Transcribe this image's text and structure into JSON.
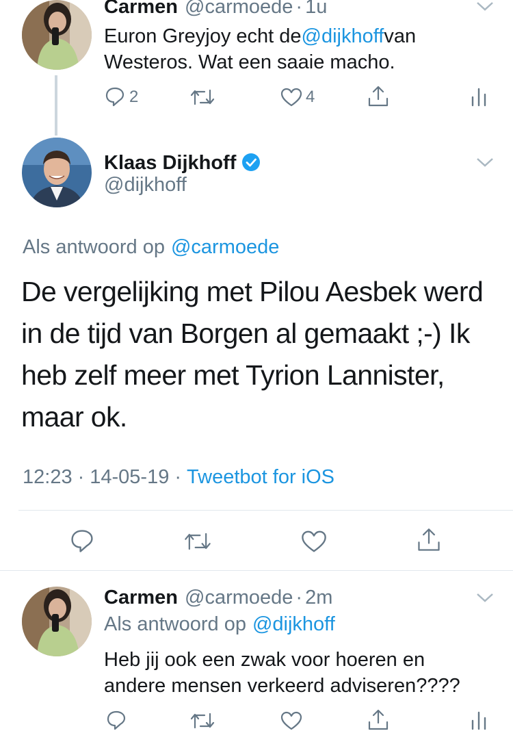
{
  "tweets": [
    {
      "name": "Carmen",
      "handle": "@carmoede",
      "sep": "·",
      "time": "1u",
      "text_parts": [
        "Euron Greyjoy echt de ",
        "@dijkhoff",
        " van"
      ],
      "text_line2": "Westeros. Wat een saaie macho.",
      "replies": "2",
      "likes": "4"
    },
    {
      "name": "Carmen",
      "handle": "@carmoede",
      "sep": "·",
      "time": "2m",
      "reply_prefix": "Als antwoord op",
      "reply_to": "@dijkhoff",
      "text_line1": "Heb jij ook een zwak voor hoeren en",
      "text_line2": "andere mensen verkeerd adviseren????"
    }
  ],
  "main": {
    "name": "Klaas Dijkhoff",
    "handle": "@dijkhoff",
    "reply_prefix": "Als antwoord op",
    "reply_to": "@carmoede",
    "lines": [
      "De vergelijking met Pilou Aesbek werd",
      "in de tijd van Borgen al gemaakt ;-) Ik",
      "heb zelf meer met Tyrion Lannister,",
      "maar ok."
    ],
    "time": "12:23",
    "sep": "·",
    "date": "14-05-19",
    "source": "Tweetbot for iOS"
  },
  "colors": {
    "link": "#1b95e0",
    "muted": "#657786",
    "verified": "#1da1f2",
    "divider": "#e1e8ed",
    "thread_line": "#ccd6dd"
  },
  "icons": [
    "reply-icon",
    "retweet-icon",
    "like-icon",
    "share-icon",
    "analytics-icon",
    "chevron-down-icon",
    "verified-badge-icon"
  ]
}
